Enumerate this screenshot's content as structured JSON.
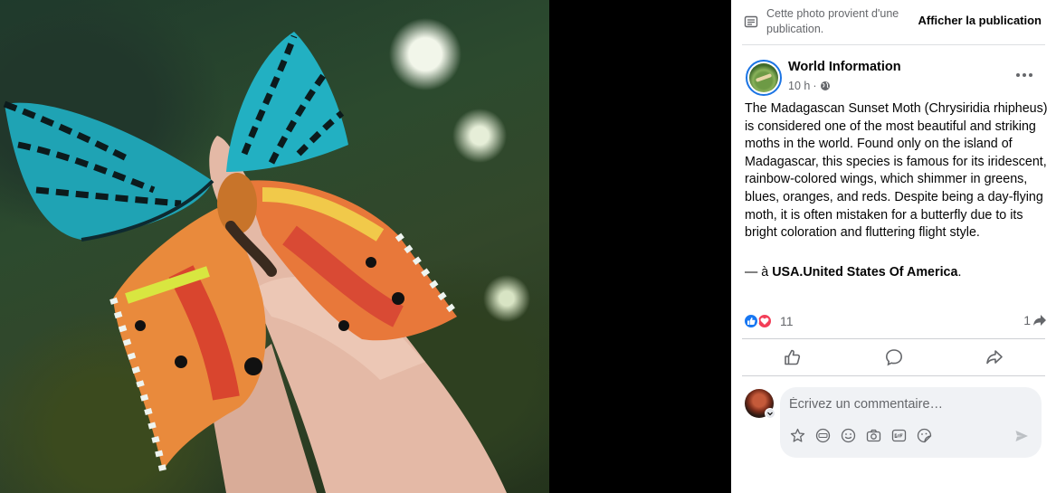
{
  "banner": {
    "from_text": "Cette photo provient d'une publication.",
    "view_post_label": "Afficher la publication"
  },
  "post": {
    "author": "World Information",
    "time": "10 h",
    "meta_separator": "·",
    "text": "The Madagascan Sunset Moth (Chrysiridia rhipheus) is considered one of the most beautiful and striking moths in the world. Found only on the island of Madagascar, this species is famous for its iridescent, rainbow-colored wings, which shimmer in greens, blues, oranges, and reds. Despite being a day-flying moth, it is often mistaken for a butterfly due to its bright coloration and fluttering flight style.",
    "location_prefix": "— à ",
    "location": "USA.United States Of America",
    "location_suffix": "."
  },
  "stats": {
    "reaction_count": "11",
    "share_count": "1",
    "reaction_icons": [
      "like-icon",
      "love-icon"
    ]
  },
  "actions": [
    "like-icon",
    "comment-icon",
    "share-icon"
  ],
  "comment": {
    "placeholder": "Écrivez un commentaire…",
    "tools": [
      "avatar-sticker-icon",
      "gif-emoji-icon",
      "emoji-icon",
      "camera-icon",
      "gif-icon",
      "sticker-icon"
    ]
  },
  "colors": {
    "accent": "#1877f2",
    "love": "#f33e58",
    "secondary_text": "#65676b",
    "comment_bg": "#f0f2f5"
  }
}
